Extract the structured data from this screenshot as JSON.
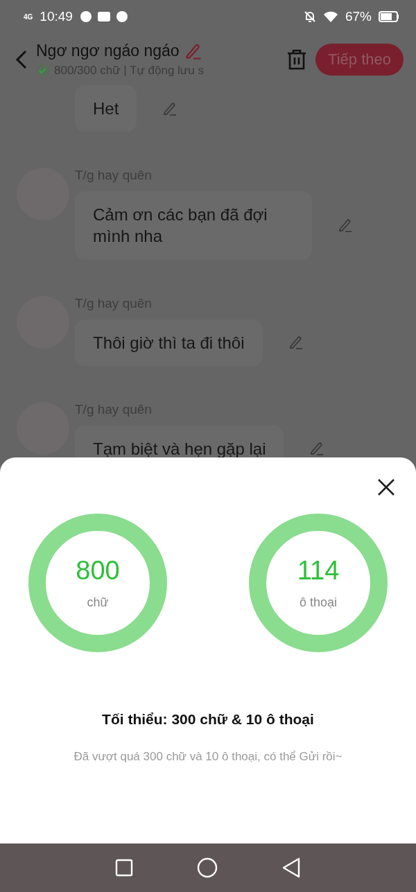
{
  "status_bar": {
    "network": "4G",
    "time": "10:49",
    "battery": "67%"
  },
  "header": {
    "title": "Ngơ ngơ ngáo ngáo",
    "subtitle": "800/300 chữ | Tự động lưu s",
    "saved": true,
    "next_button": "Tiếp theo"
  },
  "messages": [
    {
      "text": "Het"
    },
    {
      "author": "T/g hay quên",
      "text": "Cảm ơn các bạn đã đợi mình nha"
    },
    {
      "author": "T/g hay quên",
      "text": "Thôi giờ thì ta đi thôi"
    },
    {
      "author": "T/g hay quên",
      "text": "Tạm biệt và hẹn gặp lại"
    }
  ],
  "sheet": {
    "stats": [
      {
        "value": "800",
        "unit": "chữ",
        "level": 1
      },
      {
        "value": "114",
        "unit": "ô thoại",
        "level": 1
      }
    ],
    "minimum": "Tối thiểu: 300 chữ & 10 ô thoại",
    "note": "Đã vượt quá 300 chữ và 10 ô thoại, có thể Gửi rồi~"
  }
}
